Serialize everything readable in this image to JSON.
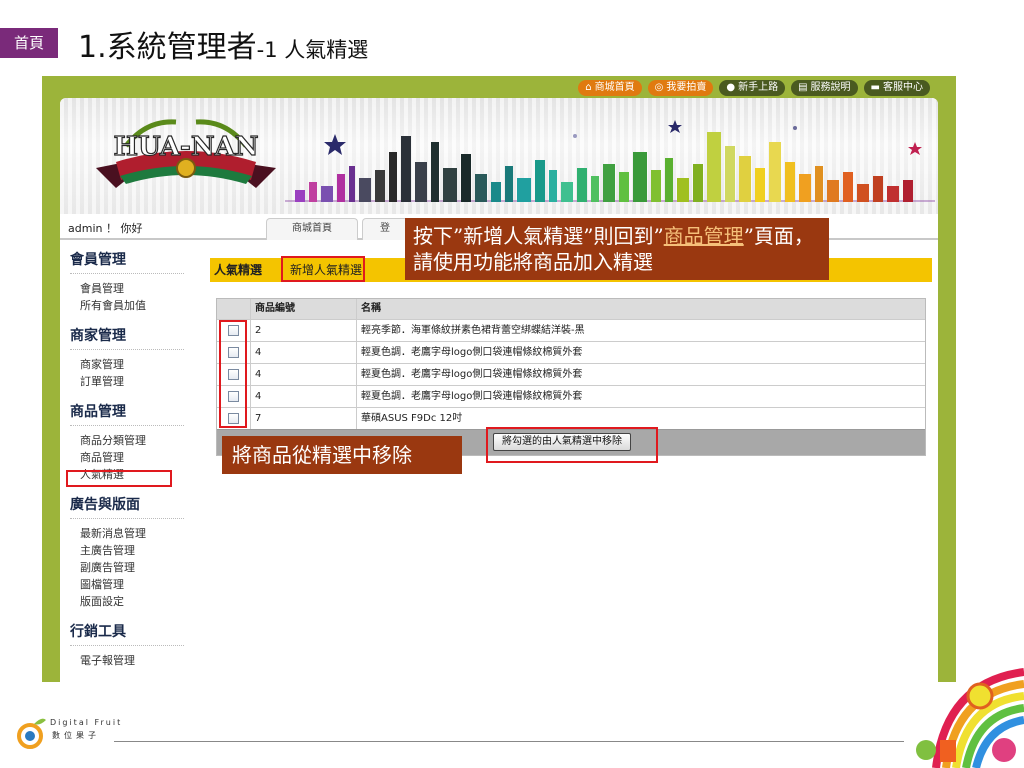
{
  "slide": {
    "home_tag": "首頁",
    "title_main": "1.系統管理者",
    "title_sub": "-1 人氣精選"
  },
  "topnav": [
    {
      "label": "商城首頁",
      "icon": "home-icon",
      "style": "orange"
    },
    {
      "label": "我要拍賣",
      "icon": "auction-icon",
      "style": "orange"
    },
    {
      "label": "新手上路",
      "icon": "user-icon",
      "style": "dark"
    },
    {
      "label": "服務說明",
      "icon": "info-icon",
      "style": "dark"
    },
    {
      "label": "客服中心",
      "icon": "chat-icon",
      "style": "dark"
    }
  ],
  "banner": {
    "logo_text": "HUA-NAN"
  },
  "userbar": {
    "greeting": "admin ！ 你好",
    "tabs": [
      "商城首頁",
      "登"
    ]
  },
  "sidebar": [
    {
      "group": "會員管理",
      "items": [
        "會員管理",
        "所有會員加值"
      ]
    },
    {
      "group": "商家管理",
      "items": [
        "商家管理",
        "訂單管理"
      ]
    },
    {
      "group": "商品管理",
      "items": [
        "商品分類管理",
        "商品管理",
        "人氣精選"
      ]
    },
    {
      "group": "廣告與版面",
      "items": [
        "最新消息管理",
        "主廣告管理",
        "副廣告管理",
        "圖檔管理",
        "版面設定"
      ]
    },
    {
      "group": "行銷工具",
      "items": [
        "電子報管理"
      ]
    }
  ],
  "content": {
    "tab_active": "人氣精選",
    "tab_add": "新增人氣精選",
    "table": {
      "headers": [
        "",
        "商品編號",
        "名稱"
      ],
      "rows": [
        {
          "id": "2",
          "name": "輕亮季節．海軍條紋拼素色裙背蕾空綁蝶結洋裝-黑"
        },
        {
          "id": "4",
          "name": "輕夏色調．老鷹字母logo側口袋連帽條紋棉質外套"
        },
        {
          "id": "4",
          "name": "輕夏色調．老鷹字母logo側口袋連帽條紋棉質外套"
        },
        {
          "id": "4",
          "name": "輕夏色調．老鷹字母logo側口袋連帽條紋棉質外套"
        },
        {
          "id": "7",
          "name": "華碩ASUS F9Dc 12吋"
        }
      ]
    },
    "remove_button": "將勾選的由人氣精選中移除"
  },
  "callouts": {
    "top_part1": "按下”新增人氣精選”則回到”",
    "top_link": "商品管理",
    "top_part2": "”頁面，請使用功能將商品加入精選",
    "bottom": "將商品從精選中移除"
  },
  "footer": {
    "brand_name": "Digital Fruit",
    "brand_cn": "數位果子"
  },
  "colors": {
    "frame_green": "#9cb43a",
    "tab_yellow": "#f4c400",
    "callout_brown": "#9a3810",
    "highlight_red": "#e0191e",
    "home_purple": "#7a2a7a"
  }
}
